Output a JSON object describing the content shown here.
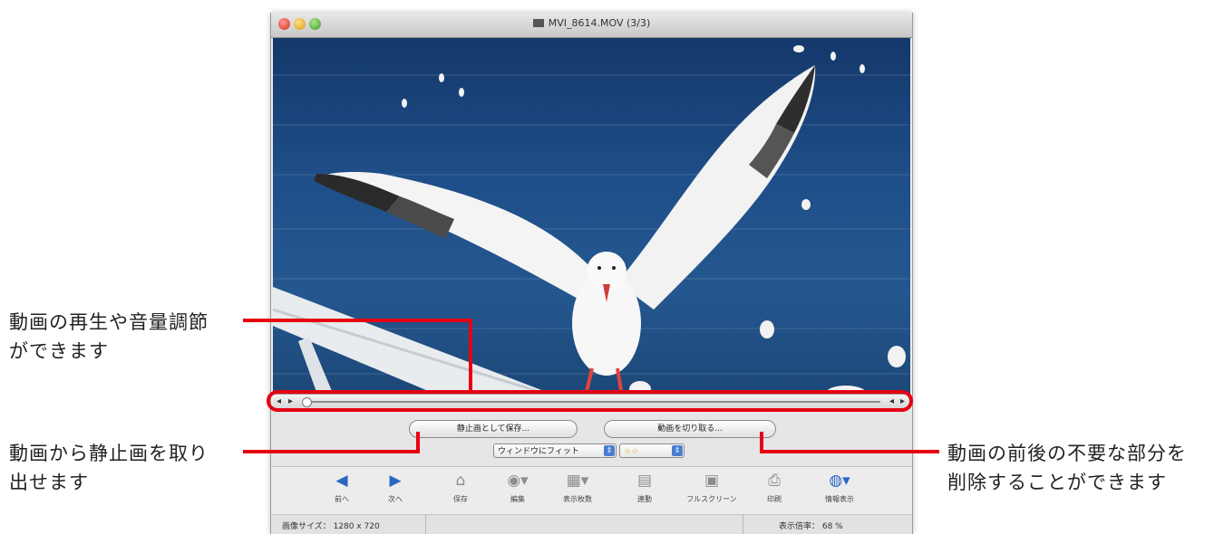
{
  "window": {
    "title": "MVI_8614.MOV (3/3)"
  },
  "controls": {
    "save_still_button": "静止画として保存...",
    "trim_button": "動画を切り取る...",
    "zoom_select": "ウィンドウにフィット",
    "rating_select": "☆☆"
  },
  "toolbar": [
    {
      "label": "前へ",
      "icon": "arrow-left-icon"
    },
    {
      "label": "次へ",
      "icon": "arrow-right-icon"
    },
    {
      "label": "保存",
      "icon": "save-icon"
    },
    {
      "label": "編集",
      "icon": "edit-icon"
    },
    {
      "label": "表示枚数",
      "icon": "view-count-icon"
    },
    {
      "label": "連動",
      "icon": "sync-icon"
    },
    {
      "label": "フルスクリーン",
      "icon": "fullscreen-icon"
    },
    {
      "label": "印刷",
      "icon": "print-icon"
    },
    {
      "label": "情報表示",
      "icon": "info-icon"
    }
  ],
  "status": {
    "image_size": "画像サイズ：  1280 x 720",
    "zoom": "表示倍率：  68 %"
  },
  "callouts": {
    "playback": [
      "動画の再生や音量調節",
      "ができます"
    ],
    "extract": [
      "動画から静止画を取り",
      "出せます"
    ],
    "trim": [
      "動画の前後の不要な部分を",
      "削除することができます"
    ]
  },
  "colors": {
    "callout_red": "#e60012",
    "sea_blue": "#1f4f8a",
    "window_bg": "#ececec"
  }
}
